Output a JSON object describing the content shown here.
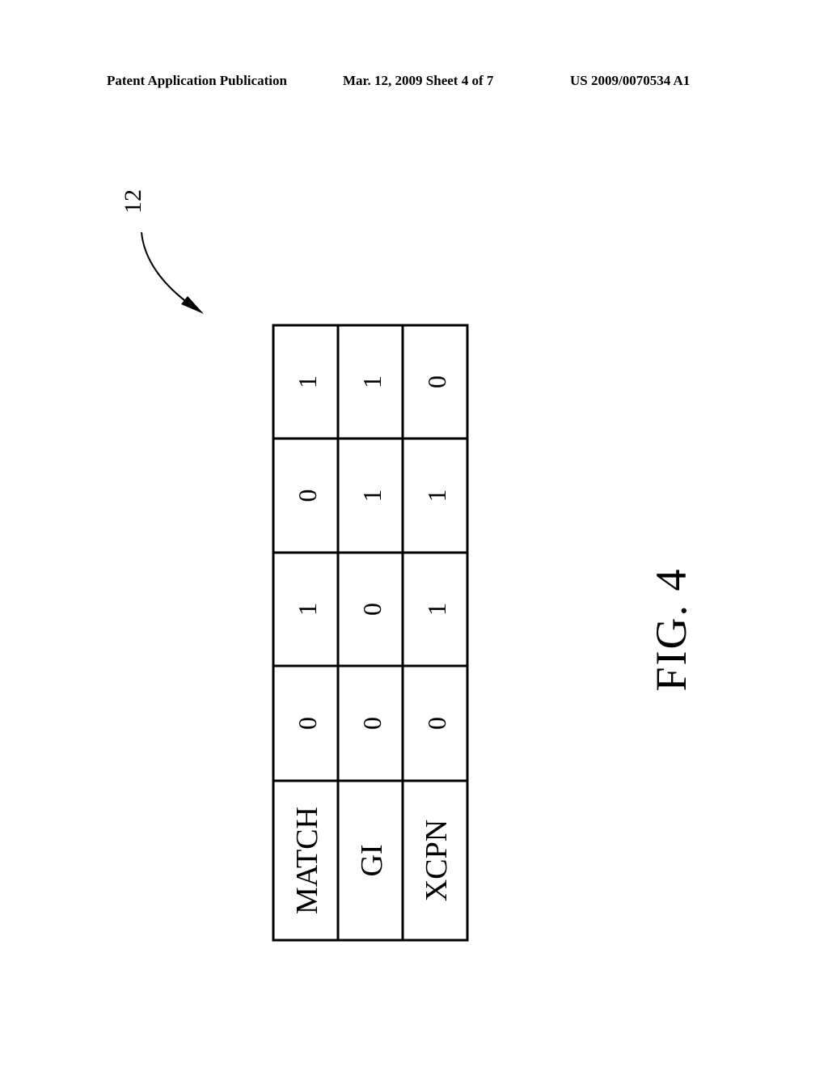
{
  "header": {
    "publication": "Patent Application Publication",
    "date_sheet": "Mar. 12, 2009  Sheet 4 of 7",
    "patent_number": "US 2009/0070534 A1"
  },
  "reference_numeral": "12",
  "figure_label": "FIG. 4",
  "table": {
    "orientation": "rotated 90° counter-clockwise",
    "columns": [
      "MATCH",
      "GI",
      "XCPN"
    ],
    "rows": [
      [
        "0",
        "0",
        "0"
      ],
      [
        "1",
        "0",
        "1"
      ],
      [
        "0",
        "1",
        "1"
      ],
      [
        "1",
        "1",
        "0"
      ]
    ]
  },
  "colors": {
    "ink": "#000000",
    "paper": "#ffffff"
  }
}
